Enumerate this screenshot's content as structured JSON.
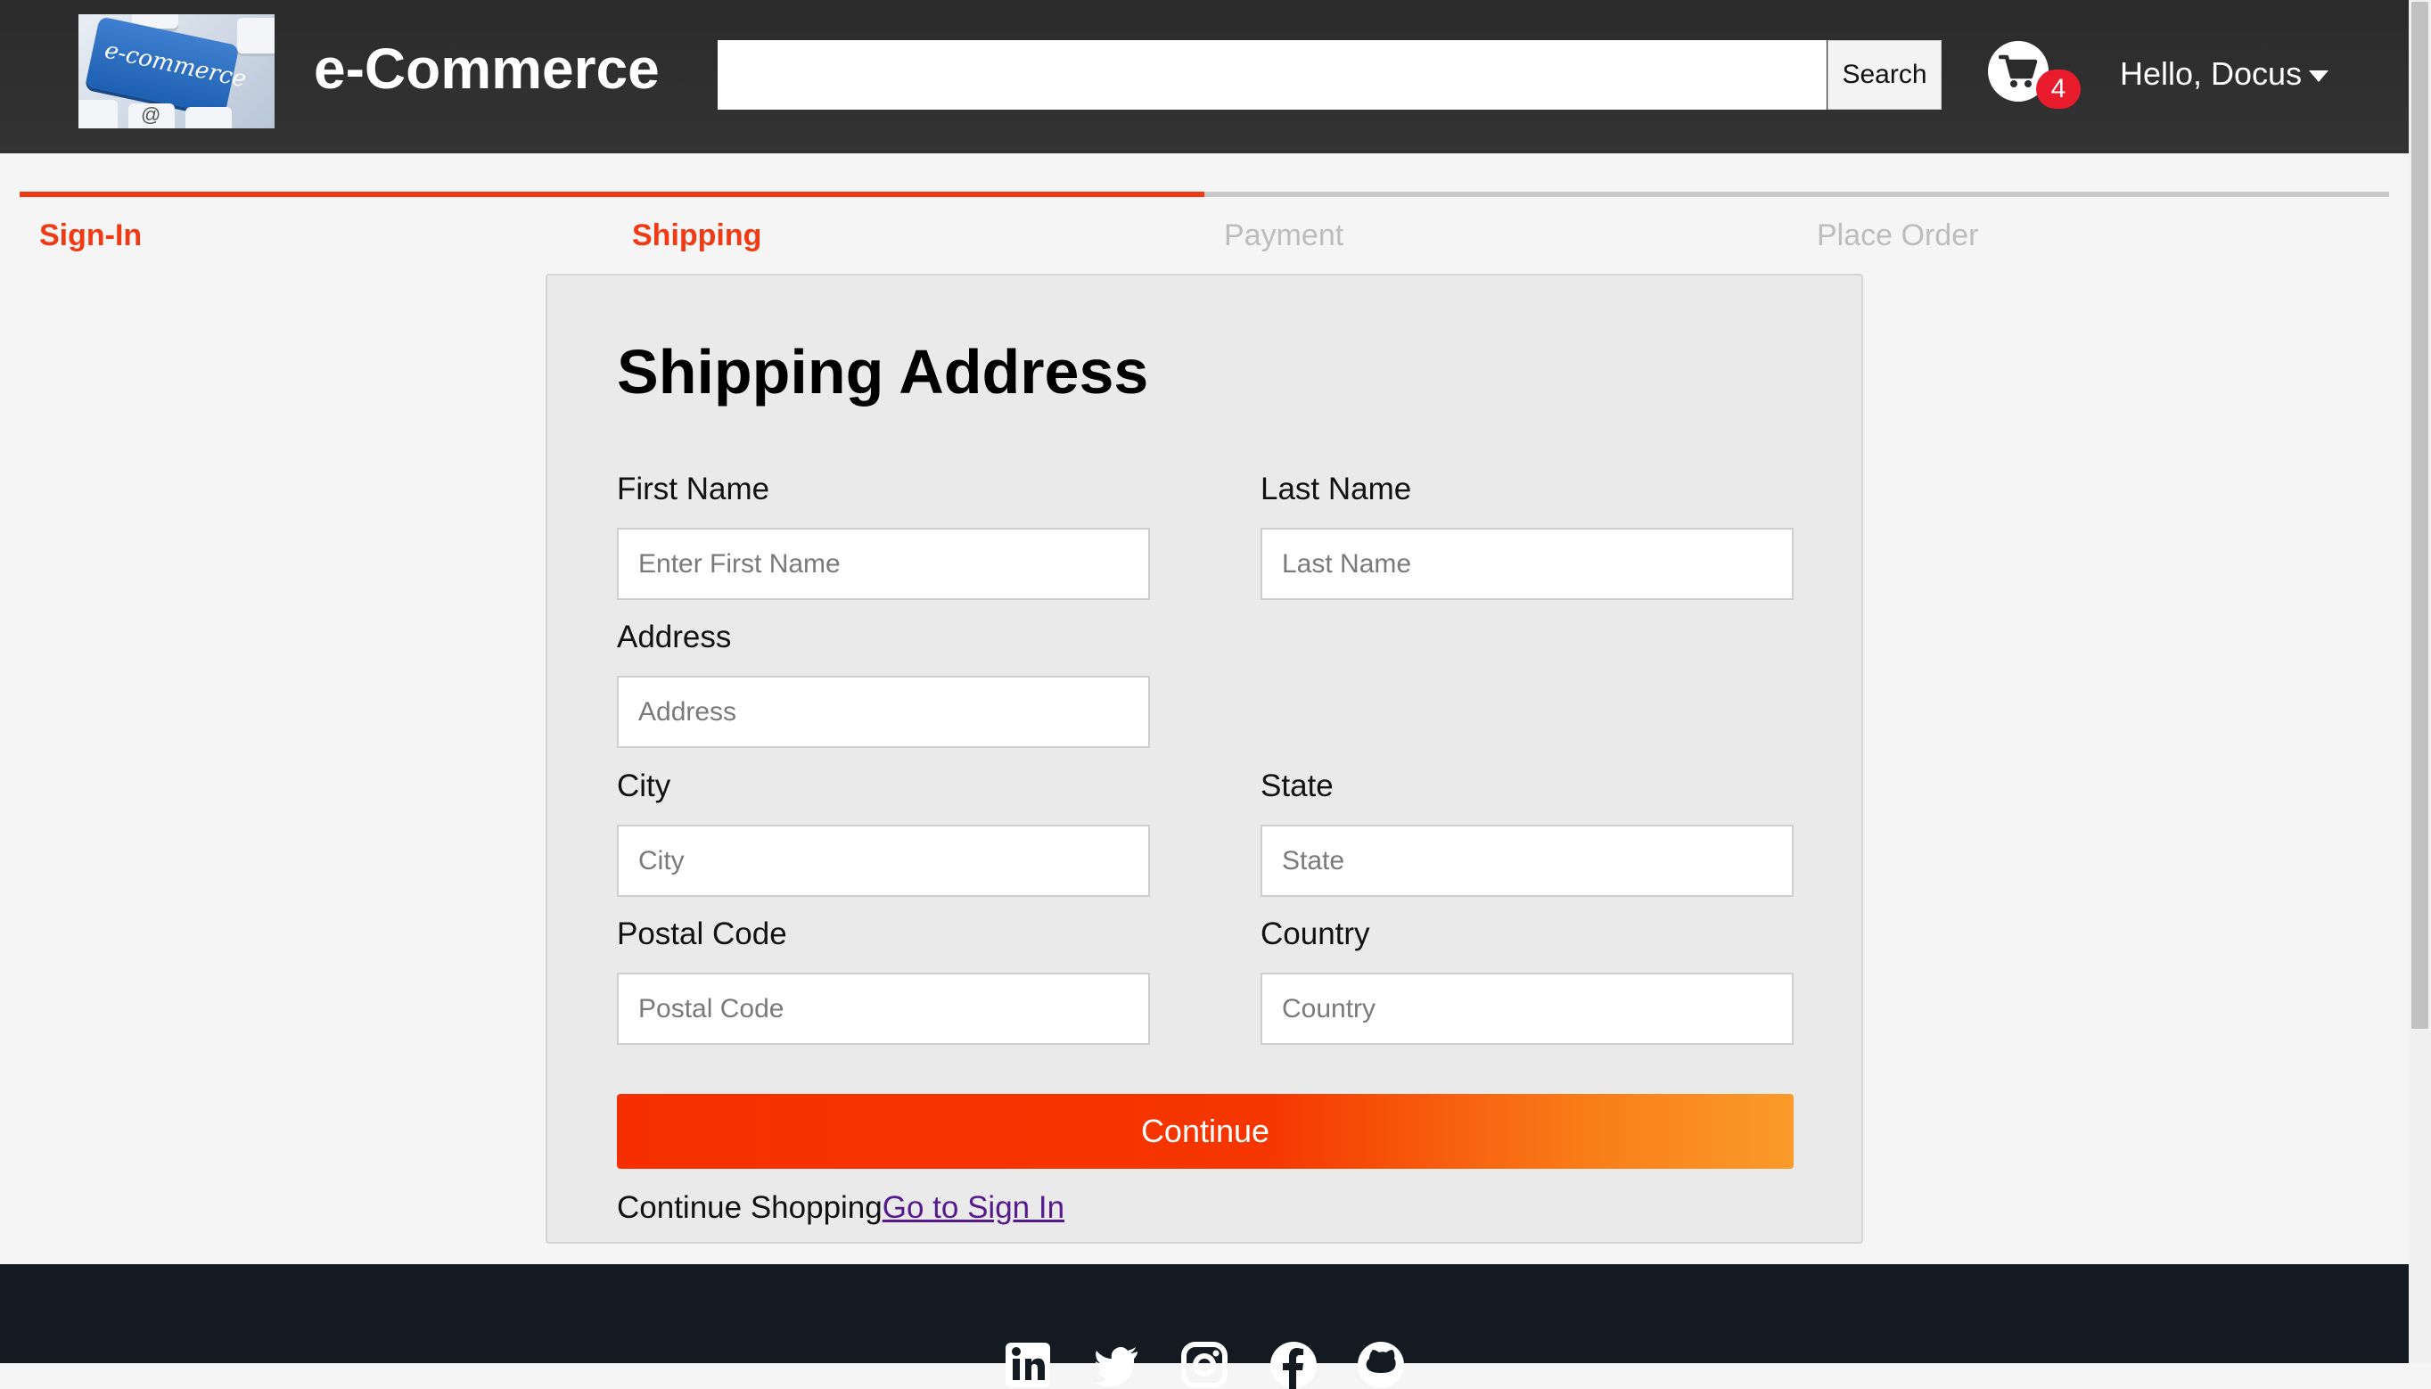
{
  "header": {
    "brand": "e-Commerce",
    "logo_text": "e-commerce",
    "search": {
      "value": "",
      "placeholder": "",
      "button_label": "Search"
    },
    "cart": {
      "icon": "cart-icon",
      "count": "4"
    },
    "user_menu": {
      "label": "Hello, Docus",
      "icon": "caret-down-icon"
    }
  },
  "steps": {
    "items": [
      {
        "label": "Sign-In",
        "state": "active"
      },
      {
        "label": "Shipping",
        "state": "active"
      },
      {
        "label": "Payment",
        "state": "inactive"
      },
      {
        "label": "Place Order",
        "state": "inactive"
      }
    ],
    "completed_fraction": 0.5
  },
  "form": {
    "title": "Shipping Address",
    "first_name": {
      "label": "First Name",
      "placeholder": "Enter First Name",
      "value": ""
    },
    "last_name": {
      "label": "Last Name",
      "placeholder": "Last Name",
      "value": ""
    },
    "address": {
      "label": "Address",
      "placeholder": "Address",
      "value": ""
    },
    "city": {
      "label": "City",
      "placeholder": "City",
      "value": ""
    },
    "state": {
      "label": "State",
      "placeholder": "State",
      "value": ""
    },
    "postal_code": {
      "label": "Postal Code",
      "placeholder": "Postal Code",
      "value": ""
    },
    "country": {
      "label": "Country",
      "placeholder": "Country",
      "value": ""
    },
    "continue_label": "Continue",
    "continue_shopping_text": "Continue Shopping",
    "sign_in_link": "Go to Sign In"
  },
  "footer": {
    "social_icons": [
      "linkedin-icon",
      "twitter-icon",
      "instagram-icon",
      "facebook-icon",
      "github-icon"
    ]
  },
  "colors": {
    "header_bg": "#2b2b2b",
    "accent": "#f13a14",
    "inactive_step": "#bdbdbd",
    "badge": "#e81c2c",
    "footer_bg": "#141a22",
    "link": "#551a8b"
  }
}
